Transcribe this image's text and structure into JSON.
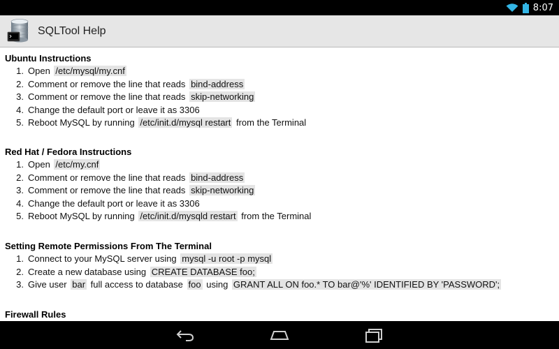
{
  "status_bar": {
    "time": "8:07",
    "icons": [
      "wifi-icon",
      "battery-icon"
    ]
  },
  "action_bar": {
    "title": "SQLTool Help",
    "icon": "database-icon"
  },
  "sections": [
    {
      "title": "Ubuntu Instructions",
      "items": [
        {
          "num": "1.",
          "parts": [
            {
              "t": "Open "
            },
            {
              "c": "/etc/mysql/my.cnf"
            }
          ]
        },
        {
          "num": "2.",
          "parts": [
            {
              "t": "Comment or remove the line that reads "
            },
            {
              "c": "bind-address"
            }
          ]
        },
        {
          "num": "3.",
          "parts": [
            {
              "t": "Comment or remove the line that reads "
            },
            {
              "c": "skip-networking"
            }
          ]
        },
        {
          "num": "4.",
          "parts": [
            {
              "t": "Change the default port or leave it as 3306"
            }
          ]
        },
        {
          "num": "5.",
          "parts": [
            {
              "t": "Reboot MySQL by running "
            },
            {
              "c": "/etc/init.d/mysql restart"
            },
            {
              "t": " from the Terminal"
            }
          ]
        }
      ]
    },
    {
      "title": "Red Hat / Fedora Instructions",
      "items": [
        {
          "num": "1.",
          "parts": [
            {
              "t": "Open "
            },
            {
              "c": "/etc/my.cnf"
            }
          ]
        },
        {
          "num": "2.",
          "parts": [
            {
              "t": "Comment or remove the line that reads "
            },
            {
              "c": "bind-address"
            }
          ]
        },
        {
          "num": "3.",
          "parts": [
            {
              "t": "Comment or remove the line that reads "
            },
            {
              "c": "skip-networking"
            }
          ]
        },
        {
          "num": "4.",
          "parts": [
            {
              "t": "Change the default port or leave it as 3306"
            }
          ]
        },
        {
          "num": "5.",
          "parts": [
            {
              "t": "Reboot MySQL by running "
            },
            {
              "c": "/etc/init.d/mysqld restart"
            },
            {
              "t": " from the Terminal"
            }
          ]
        }
      ]
    },
    {
      "title": "Setting Remote Permissions From The Terminal",
      "items": [
        {
          "num": "1.",
          "parts": [
            {
              "t": "Connect to your MySQL server using "
            },
            {
              "c": "mysql -u root -p mysql"
            }
          ]
        },
        {
          "num": "2.",
          "parts": [
            {
              "t": "Create a new database using "
            },
            {
              "c": "CREATE DATABASE foo;"
            }
          ]
        },
        {
          "num": "3.",
          "parts": [
            {
              "t": "Give user "
            },
            {
              "c": "bar"
            },
            {
              "t": " full access to database "
            },
            {
              "c": "foo"
            },
            {
              "t": " using "
            },
            {
              "c": "GRANT ALL ON foo.* TO bar@'%' IDENTIFIED BY 'PASSWORD';"
            }
          ]
        }
      ]
    },
    {
      "title": "Firewall Rules",
      "items": []
    }
  ],
  "nav_bar": {
    "buttons": [
      "back-icon",
      "home-icon",
      "recent-apps-icon"
    ]
  }
}
